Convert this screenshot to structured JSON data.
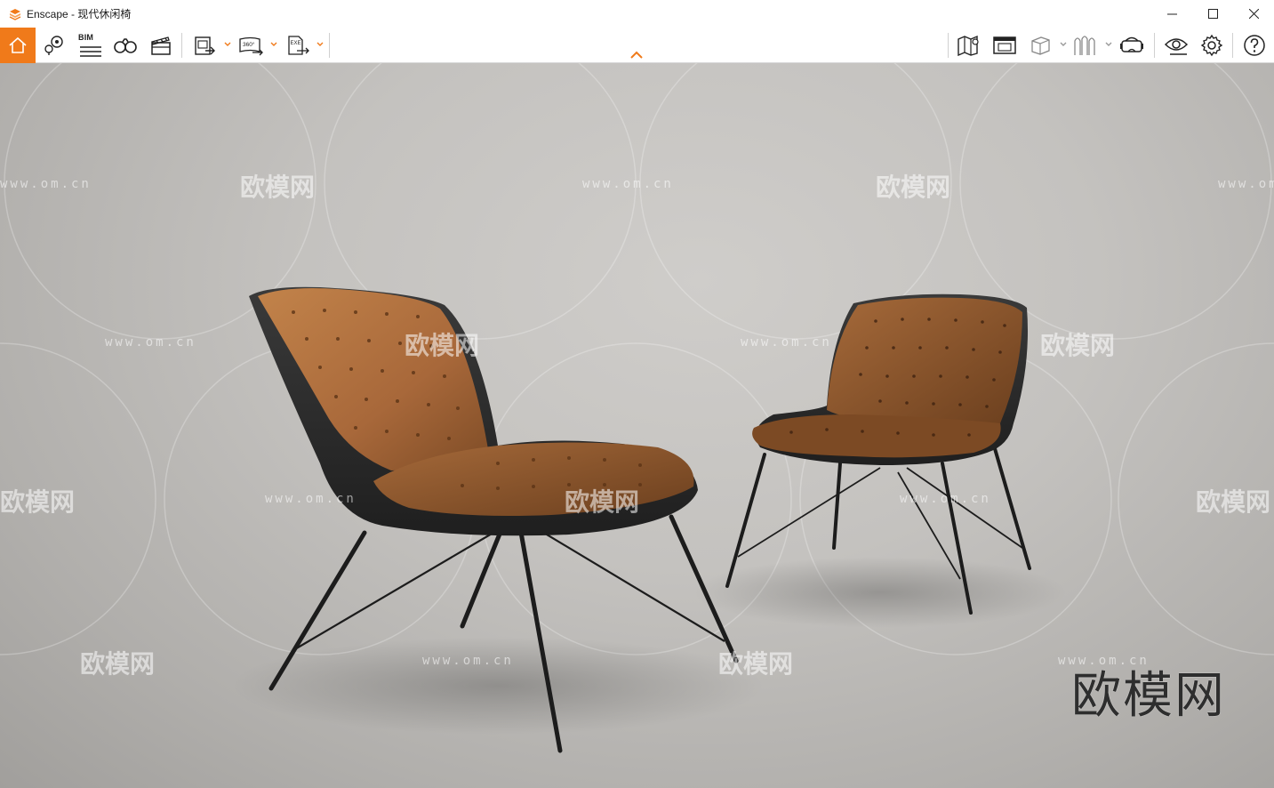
{
  "window": {
    "title": "Enscape - 现代休闲椅",
    "controls": [
      "minimize",
      "maximize",
      "close"
    ]
  },
  "toolbar": {
    "left_buttons": [
      {
        "name": "home-icon",
        "active": true
      },
      {
        "name": "location-icon"
      },
      {
        "name": "bim-icon",
        "label": "BIM"
      },
      {
        "name": "binoculars-icon"
      },
      {
        "name": "clapperboard-icon"
      },
      {
        "name": "render-image-icon",
        "dropdown": true
      },
      {
        "name": "panorama-360-icon",
        "label": "360°",
        "dropdown": true
      },
      {
        "name": "export-exe-icon",
        "label": "EXE",
        "dropdown": true
      }
    ],
    "right_buttons": [
      {
        "name": "map-icon"
      },
      {
        "name": "views-icon"
      },
      {
        "name": "box-icon",
        "dropdown": true
      },
      {
        "name": "materials-icon",
        "dropdown": true
      },
      {
        "name": "vr-headset-icon"
      },
      {
        "name": "visual-settings-icon"
      },
      {
        "name": "settings-gear-icon"
      },
      {
        "name": "help-icon"
      }
    ],
    "accent_color": "#f07a1a"
  },
  "viewport": {
    "watermark_url": "www.om.cn",
    "watermark_brand": "欧模网",
    "brand_mark": "欧模网"
  }
}
